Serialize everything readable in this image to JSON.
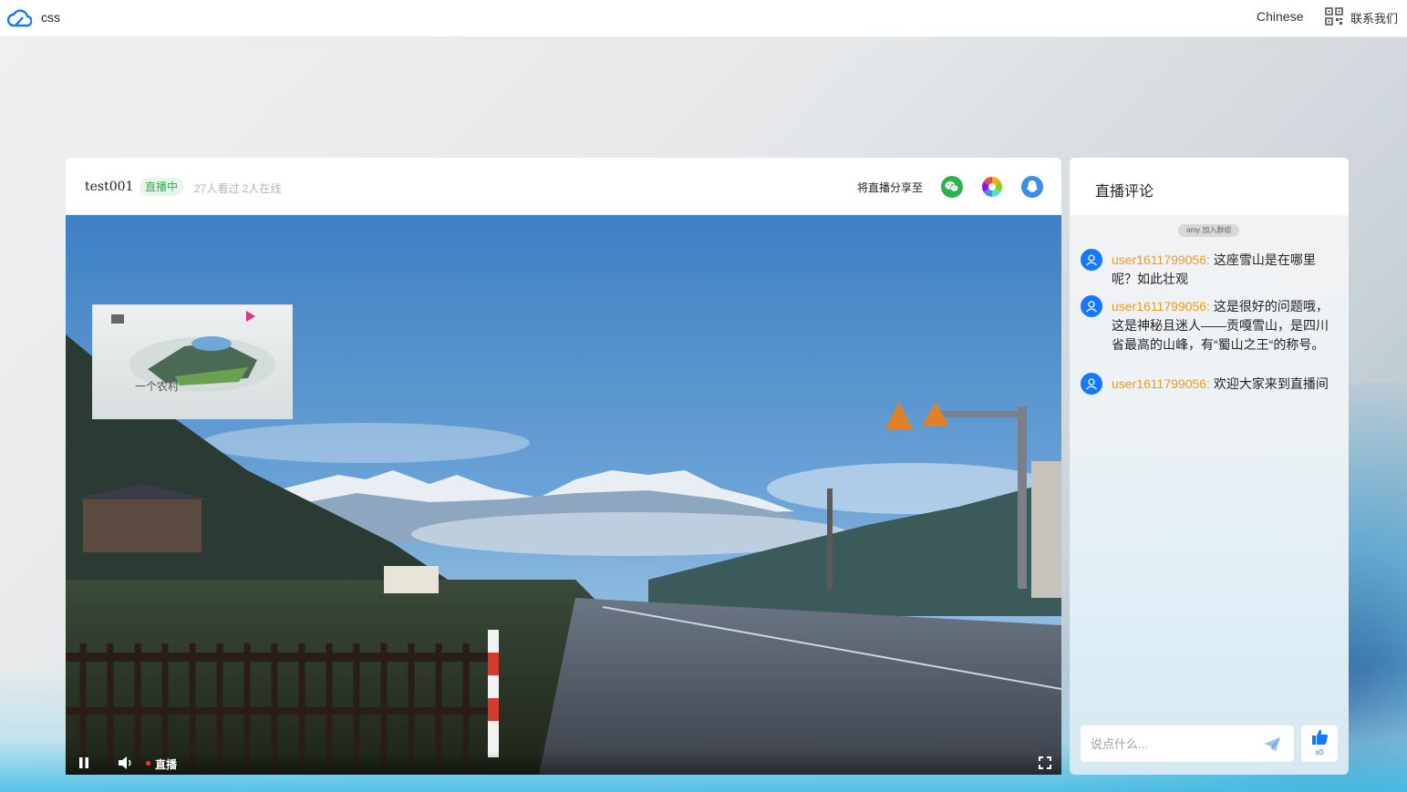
{
  "nav": {
    "brand": "css",
    "language": "Chinese",
    "contact": "联系我们"
  },
  "player": {
    "room_name": "test001",
    "live_badge": "直播中",
    "viewer_stats": "27人看过 2人在线",
    "share_label": "将直播分享至",
    "share_targets": [
      "wechat-icon",
      "moments-icon",
      "qq-icon"
    ],
    "pip_text": "一个农村",
    "controls": {
      "live_label": "直播"
    }
  },
  "comments": {
    "title": "直播评论",
    "join_notice": "amy 加入群组",
    "messages": [
      {
        "user": "user1611799056:",
        "text": " 这座雪山是在哪里呢？如此壮观"
      },
      {
        "user": "user1611799056:",
        "text": " 这是很好的问题哦，这是神秘且迷人——贡嘎雪山，是四川省最高的山峰，有“蜀山之王“的称号。"
      },
      {
        "user": "user1611799056:",
        "text": " 欢迎大家来到直播间"
      }
    ],
    "input_placeholder": "说点什么...",
    "like_count": "x0"
  },
  "colors": {
    "accent": "#1677ff",
    "live_green": "#2bb24c",
    "username": "#f29b18"
  }
}
